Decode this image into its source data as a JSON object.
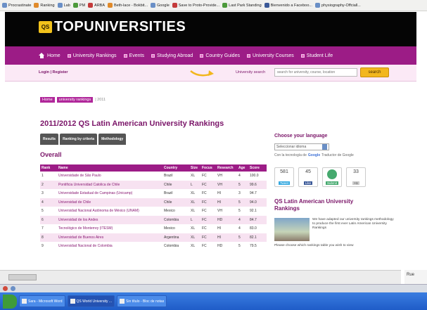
{
  "bookmarks": [
    "Procrastinate",
    "Ranking",
    "Lab",
    "PM",
    "ARBA",
    "Beth-lace - Bokbit...",
    "Google",
    "Save to Proto-Provide...",
    "Last Park Standing",
    "Bienvenido a Faceboo...",
    "physiography-Offciall..."
  ],
  "site": {
    "logo_mark": "QS",
    "logo_text": "TOPUNIVERSITIES"
  },
  "nav": [
    "Home",
    "University Rankings",
    "Events",
    "Studying Abroad",
    "Country Guides",
    "University Courses",
    "Student Life"
  ],
  "subbar": {
    "login": "Login | Register",
    "search_label": "University search",
    "search_placeholder": "search for university, course, location",
    "search_button": "search"
  },
  "breadcrumb": {
    "items": [
      "Home",
      "university rankings"
    ],
    "current": "| 2011"
  },
  "page_title": "2011/2012 QS Latin American University Rankings",
  "tabs": [
    "Results",
    "Ranking by criteria",
    "Methodology"
  ],
  "section_title": "Overall",
  "table": {
    "columns": [
      "Rank",
      "Name",
      "Country",
      "Size",
      "Focus",
      "Research",
      "Age",
      "Score"
    ],
    "rows": [
      [
        "1",
        "Universidade de São Paulo",
        "Brazil",
        "XL",
        "FC",
        "VH",
        "4",
        "100.0"
      ],
      [
        "2",
        "Pontificia Universidad Catolica de Chile",
        "Chile",
        "L",
        "FC",
        "VH",
        "5",
        "99.6"
      ],
      [
        "3",
        "Universidade Estadual de Campinas (Unicamp)",
        "Brazil",
        "XL",
        "FC",
        "HI",
        "3",
        "94.7"
      ],
      [
        "4",
        "Universidad de Chile",
        "Chile",
        "XL",
        "FC",
        "HI",
        "5",
        "94.0"
      ],
      [
        "5",
        "Universidad Nacional Autónoma de México (UNAM)",
        "Mexico",
        "XL",
        "FC",
        "VH",
        "5",
        "92.1"
      ],
      [
        "6",
        "Universidad de los Andes",
        "Colombia",
        "L",
        "FC",
        "HD",
        "4",
        "84.7"
      ],
      [
        "7",
        "Tecnológico de Monterrey (ITESM)",
        "Mexico",
        "XL",
        "FC",
        "HI",
        "4",
        "83.0"
      ],
      [
        "8",
        "Universidad de Buenos Aires",
        "Argentina",
        "XL",
        "FC",
        "HI",
        "5",
        "82.1"
      ],
      [
        "9",
        "Universidad Nacional de Colombia",
        "Colombia",
        "XL",
        "FC",
        "HD",
        "5",
        "79.5"
      ]
    ]
  },
  "sidebar": {
    "lang_title": "Choose your language",
    "lang_select": "Seleccionar idioma",
    "powered_prefix": "Con la tecnología de",
    "powered_brand": "Google",
    "powered_suffix": "Traductor de Google",
    "social": [
      {
        "count": "581",
        "label": "Tweet"
      },
      {
        "count": "45",
        "label": "Like"
      },
      {
        "count": "",
        "label": "Submit"
      },
      {
        "count": "33",
        "label": "+1"
      }
    ],
    "qs_title": "QS Latin American University Rankings",
    "qs_text": "We have adapted our university rankings methodology to produce the first ever Latin American University Rankings",
    "qs_more": "Please choose which rankings table you wish to view"
  },
  "status": {
    "right_text": "Rue"
  },
  "taskbar": [
    "Inicio",
    "Sara - Microsoft Word",
    "QS World University ...",
    "Sin título - Bloc de notas"
  ]
}
